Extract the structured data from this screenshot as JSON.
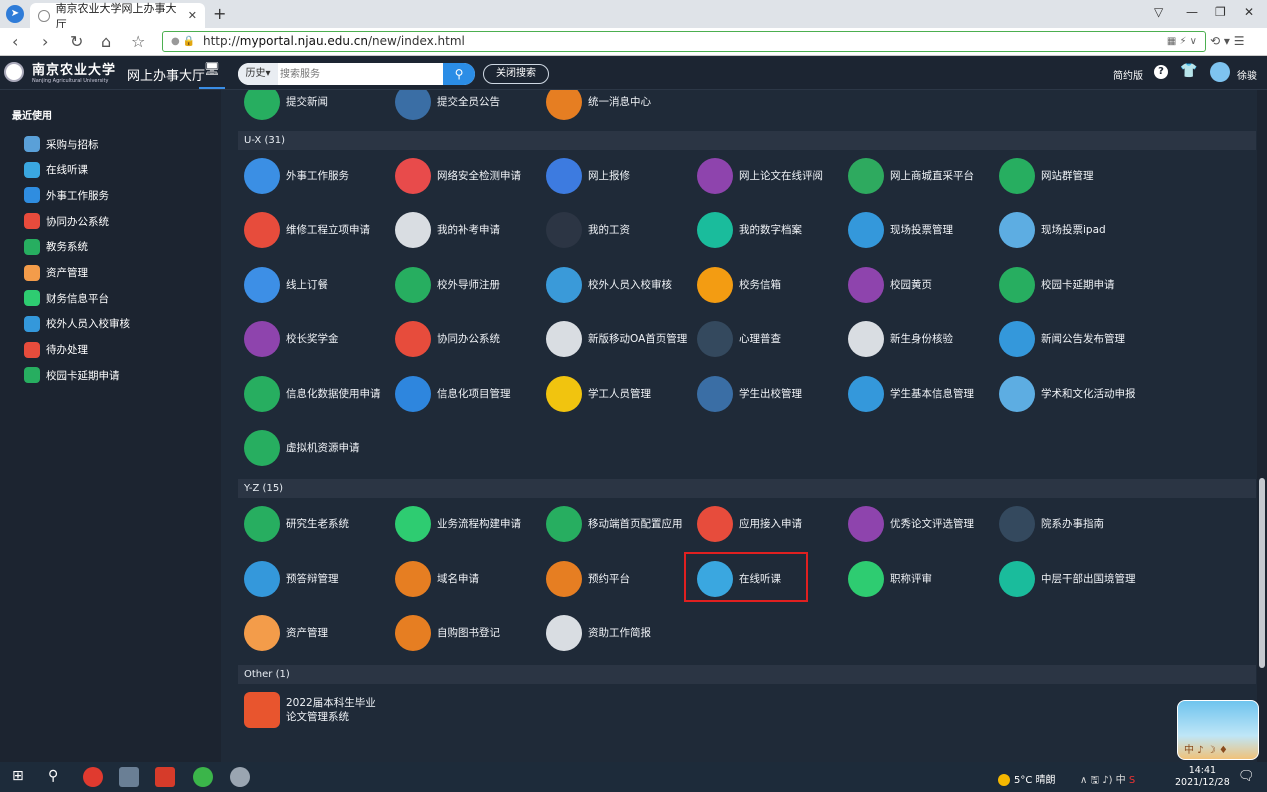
{
  "browser": {
    "tab_title": "南京农业大学网上办事大厅",
    "url_prefix": "http://",
    "url_domain": "myportal.njau.edu.cn",
    "url_path": "/new/index.html"
  },
  "header": {
    "university_name": "南京农业大学",
    "university_en": "Nanjing Agricultural University",
    "portal_title": "网上办事大厅",
    "history_label": "历史▾",
    "search_placeholder": "搜索服务",
    "close_search": "关闭搜索",
    "simple_mode": "简约版",
    "username": "徐骏"
  },
  "sidebar": {
    "title": "最近使用",
    "items": [
      {
        "label": "采购与招标",
        "color": "#5aa0d8"
      },
      {
        "label": "在线听课",
        "color": "#3aa7e0"
      },
      {
        "label": "外事工作服务",
        "color": "#2f8de0"
      },
      {
        "label": "协同办公系统",
        "color": "#e84b3c"
      },
      {
        "label": "教务系统",
        "color": "#27ae60"
      },
      {
        "label": "资产管理",
        "color": "#f39c4a"
      },
      {
        "label": "财务信息平台",
        "color": "#2ecc71"
      },
      {
        "label": "校外人员入校审核",
        "color": "#3498db"
      },
      {
        "label": "待办处理",
        "color": "#e74c3c"
      },
      {
        "label": "校园卡延期申请",
        "color": "#27ae60"
      }
    ]
  },
  "partial_row": [
    "提交新闻",
    "提交全员公告",
    "统一消息中心"
  ],
  "sections": [
    {
      "title": "U-X (31)",
      "apps": [
        {
          "label": "外事工作服务",
          "color": "#3b8fe4"
        },
        {
          "label": "网络安全检测申请",
          "color": "#e84b4b"
        },
        {
          "label": "网上报修",
          "color": "#3d7be0"
        },
        {
          "label": "网上论文在线评阅",
          "color": "#8e44ad"
        },
        {
          "label": "网上商城直采平台",
          "color": "#2eaa5f"
        },
        {
          "label": "网站群管理",
          "color": "#27ae60"
        },
        {
          "label": "维修工程立项申请",
          "color": "#e74c3c"
        },
        {
          "label": "我的补考申请",
          "color": "#d9dde2"
        },
        {
          "label": "我的工资",
          "color": "#2c3544"
        },
        {
          "label": "我的数字档案",
          "color": "#1abc9c"
        },
        {
          "label": "现场投票管理",
          "color": "#3498db"
        },
        {
          "label": "现场投票ipad",
          "color": "#5dade2"
        },
        {
          "label": "线上订餐",
          "color": "#3d8fe6"
        },
        {
          "label": "校外导师注册",
          "color": "#27ae60"
        },
        {
          "label": "校外人员入校审核",
          "color": "#3a9ad9"
        },
        {
          "label": "校务信箱",
          "color": "#f39c12"
        },
        {
          "label": "校园黄页",
          "color": "#8e44ad"
        },
        {
          "label": "校园卡延期申请",
          "color": "#27ae60"
        },
        {
          "label": "校长奖学金",
          "color": "#8e44ad"
        },
        {
          "label": "协同办公系统",
          "color": "#e74c3c"
        },
        {
          "label": "新版移动OA首页管理",
          "color": "#d9dde2"
        },
        {
          "label": "心理普查",
          "color": "#34495e"
        },
        {
          "label": "新生身份核验",
          "color": "#d9dde2"
        },
        {
          "label": "新闻公告发布管理",
          "color": "#3498db"
        },
        {
          "label": "信息化数据使用申请",
          "color": "#27ae60"
        },
        {
          "label": "信息化项目管理",
          "color": "#2e86de"
        },
        {
          "label": "学工人员管理",
          "color": "#f1c40f"
        },
        {
          "label": "学生出校管理",
          "color": "#3a6ea5"
        },
        {
          "label": "学生基本信息管理",
          "color": "#3498db"
        },
        {
          "label": "学术和文化活动申报",
          "color": "#5dade2"
        },
        {
          "label": "虚拟机资源申请",
          "color": "#27ae60"
        }
      ]
    },
    {
      "title": "Y-Z (15)",
      "apps": [
        {
          "label": "研究生老系统",
          "color": "#27ae60"
        },
        {
          "label": "业务流程构建申请",
          "color": "#2ecc71"
        },
        {
          "label": "移动端首页配置应用",
          "color": "#27ae60"
        },
        {
          "label": "应用接入申请",
          "color": "#e74c3c"
        },
        {
          "label": "优秀论文评选管理",
          "color": "#8e44ad"
        },
        {
          "label": "院系办事指南",
          "color": "#34495e"
        },
        {
          "label": "预答辩管理",
          "color": "#3498db"
        },
        {
          "label": "域名申请",
          "color": "#e67e22"
        },
        {
          "label": "预约平台",
          "color": "#e67e22"
        },
        {
          "label": "在线听课",
          "color": "#3aa7e0"
        },
        {
          "label": "职称评审",
          "color": "#2ecc71"
        },
        {
          "label": "中层干部出国境管理",
          "color": "#1abc9c"
        },
        {
          "label": "资产管理",
          "color": "#f39c4a"
        },
        {
          "label": "自购图书登记",
          "color": "#e67e22"
        },
        {
          "label": "资助工作简报",
          "color": "#d9dde2"
        }
      ]
    },
    {
      "title": "Other (1)",
      "apps": [
        {
          "label": "2022届本科生毕业论文管理系统",
          "color": "#e8552e"
        }
      ]
    }
  ],
  "widget": {
    "text": "中 ♪ ☽ ♦"
  },
  "taskbar": {
    "weather": "5°C 晴朗",
    "ime": "中",
    "time": "14:41",
    "date": "2021/12/28"
  }
}
